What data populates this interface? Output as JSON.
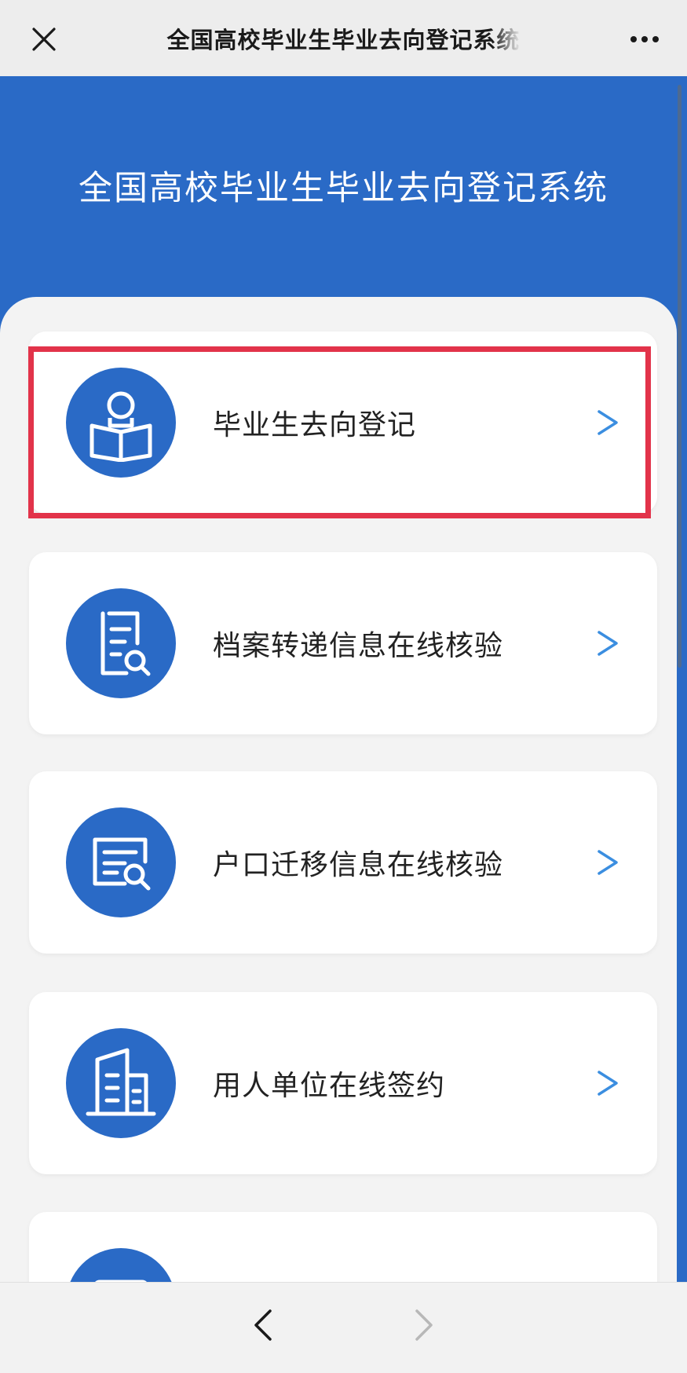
{
  "topbar": {
    "title": "全国高校毕业生毕业去向登记系统",
    "close_icon": "close-icon",
    "more_icon": "more-icon"
  },
  "header": {
    "title": "全国高校毕业生毕业去向登记系统"
  },
  "menu": {
    "items": [
      {
        "label": "毕业生去向登记",
        "icon": "person-reading-icon",
        "chevron": ">"
      },
      {
        "label": "档案转递信息在线核验",
        "icon": "document-search-icon",
        "chevron": ">"
      },
      {
        "label": "户口迁移信息在线核验",
        "icon": "form-search-icon",
        "chevron": ">"
      },
      {
        "label": "用人单位在线签约",
        "icon": "building-icon",
        "chevron": ">"
      },
      {
        "label": "",
        "icon": "id-card-icon",
        "chevron": ""
      }
    ]
  },
  "colors": {
    "brand_blue": "#2a6ac6",
    "highlight_red": "#e2334a",
    "chevron_blue": "#3b8ee0"
  },
  "bottombar": {
    "back_icon": "back-arrow-icon",
    "forward_icon": "forward-arrow-icon"
  }
}
